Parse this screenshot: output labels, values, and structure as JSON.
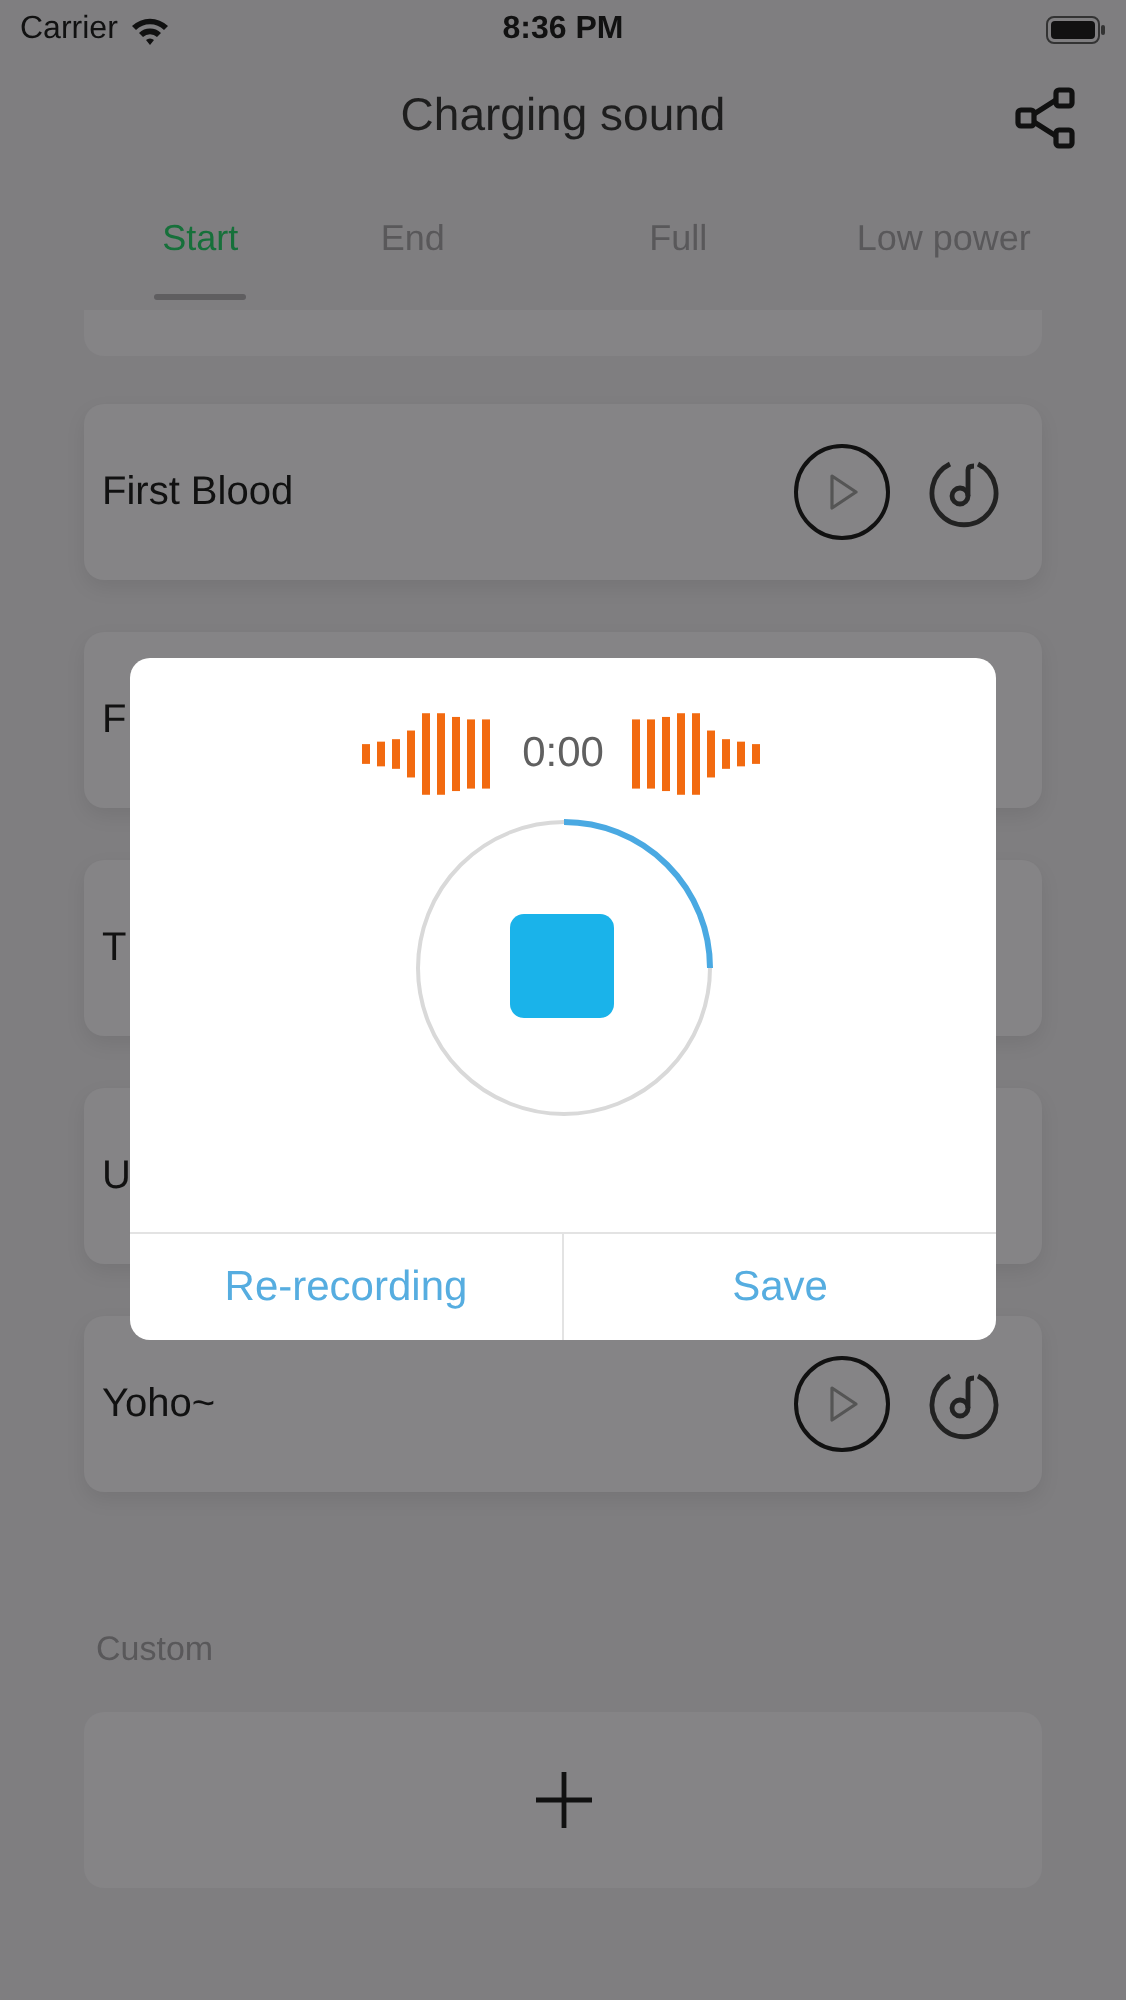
{
  "status_bar": {
    "carrier": "Carrier",
    "time": "8:36 PM"
  },
  "header": {
    "title": "Charging sound"
  },
  "tabs": [
    {
      "label": "Start",
      "selected": true
    },
    {
      "label": "End",
      "selected": false
    },
    {
      "label": "Full",
      "selected": false
    },
    {
      "label": "Low power",
      "selected": false
    }
  ],
  "sounds": [
    {
      "name": "First Blood",
      "controls_visible": true
    },
    {
      "name": "F",
      "controls_visible": false
    },
    {
      "name": "T",
      "controls_visible": false
    },
    {
      "name": "U",
      "controls_visible": false
    },
    {
      "name": "Yoho~",
      "controls_visible": true
    }
  ],
  "custom": {
    "label": "Custom"
  },
  "recording_dialog": {
    "timer": "0:00",
    "level": 0.25,
    "buttons": [
      "Re-recording",
      "Save"
    ]
  }
}
